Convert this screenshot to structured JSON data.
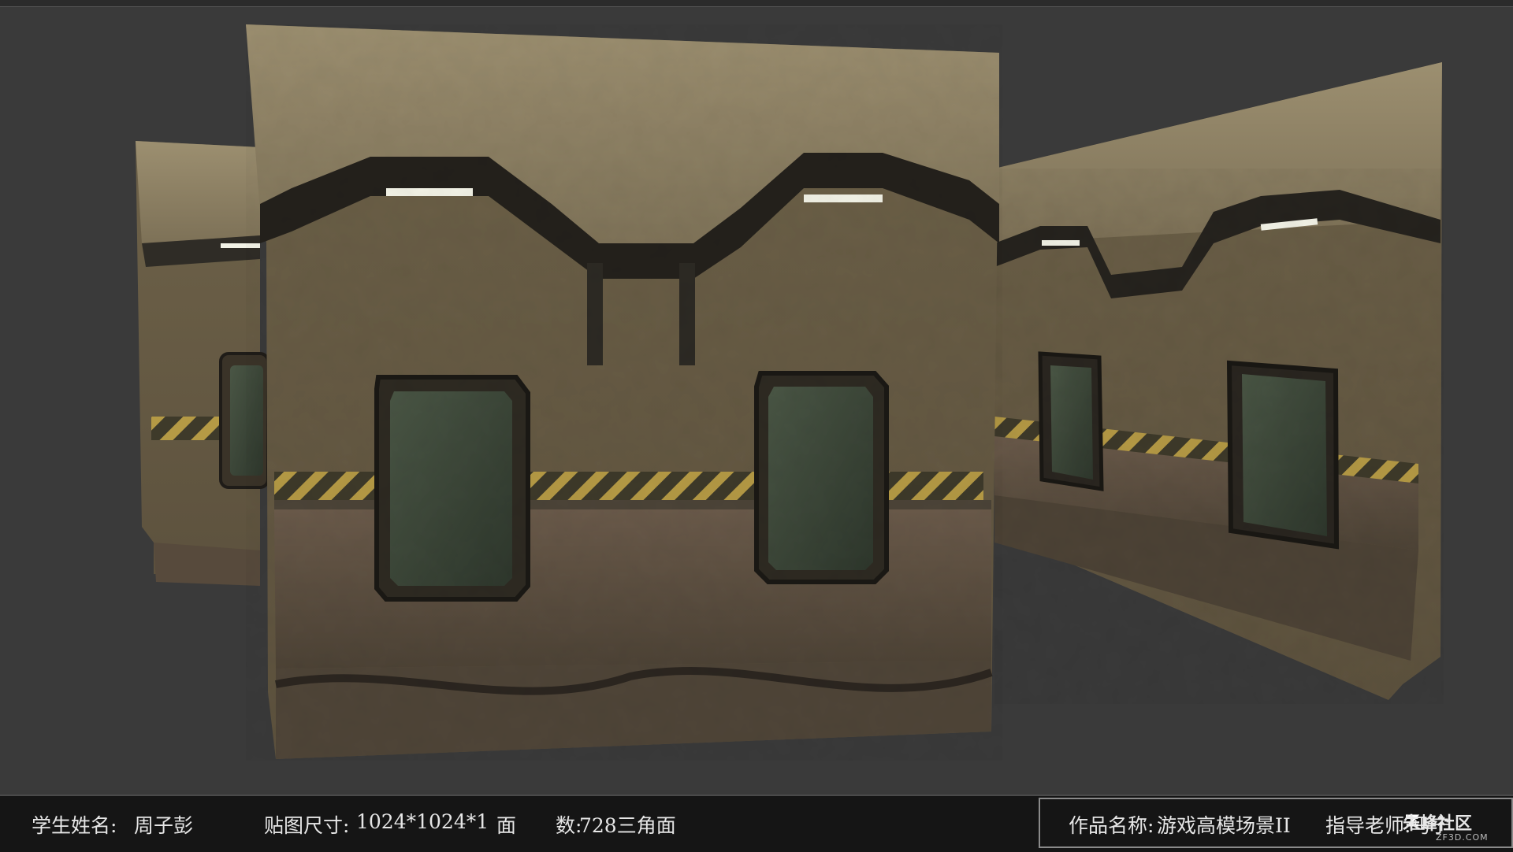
{
  "scene": {
    "background": "#3a3a3a",
    "subject": "game-scene-wall-modules",
    "colors": {
      "concrete": "#8a7c5e",
      "concrete_dark": "#5a4f3c",
      "window_glass": "#3b4536",
      "hazard_yellow": "#b59a45",
      "light_strip": "#f2f2e6"
    }
  },
  "info": {
    "student_label": "学生姓名:",
    "student_name": "周子彭",
    "texture_label": "贴图尺寸:",
    "texture_size": "1024*1024*1",
    "faces_label": "面　　数:",
    "faces_value": "728三角面",
    "work_label": "作品名称:",
    "work_name": "游戏高模场景II",
    "teacher_label": "指导老师:",
    "teacher_name": "马宁"
  },
  "watermark": {
    "text": "朱峰社区",
    "sub": "ZF3D.COM"
  }
}
